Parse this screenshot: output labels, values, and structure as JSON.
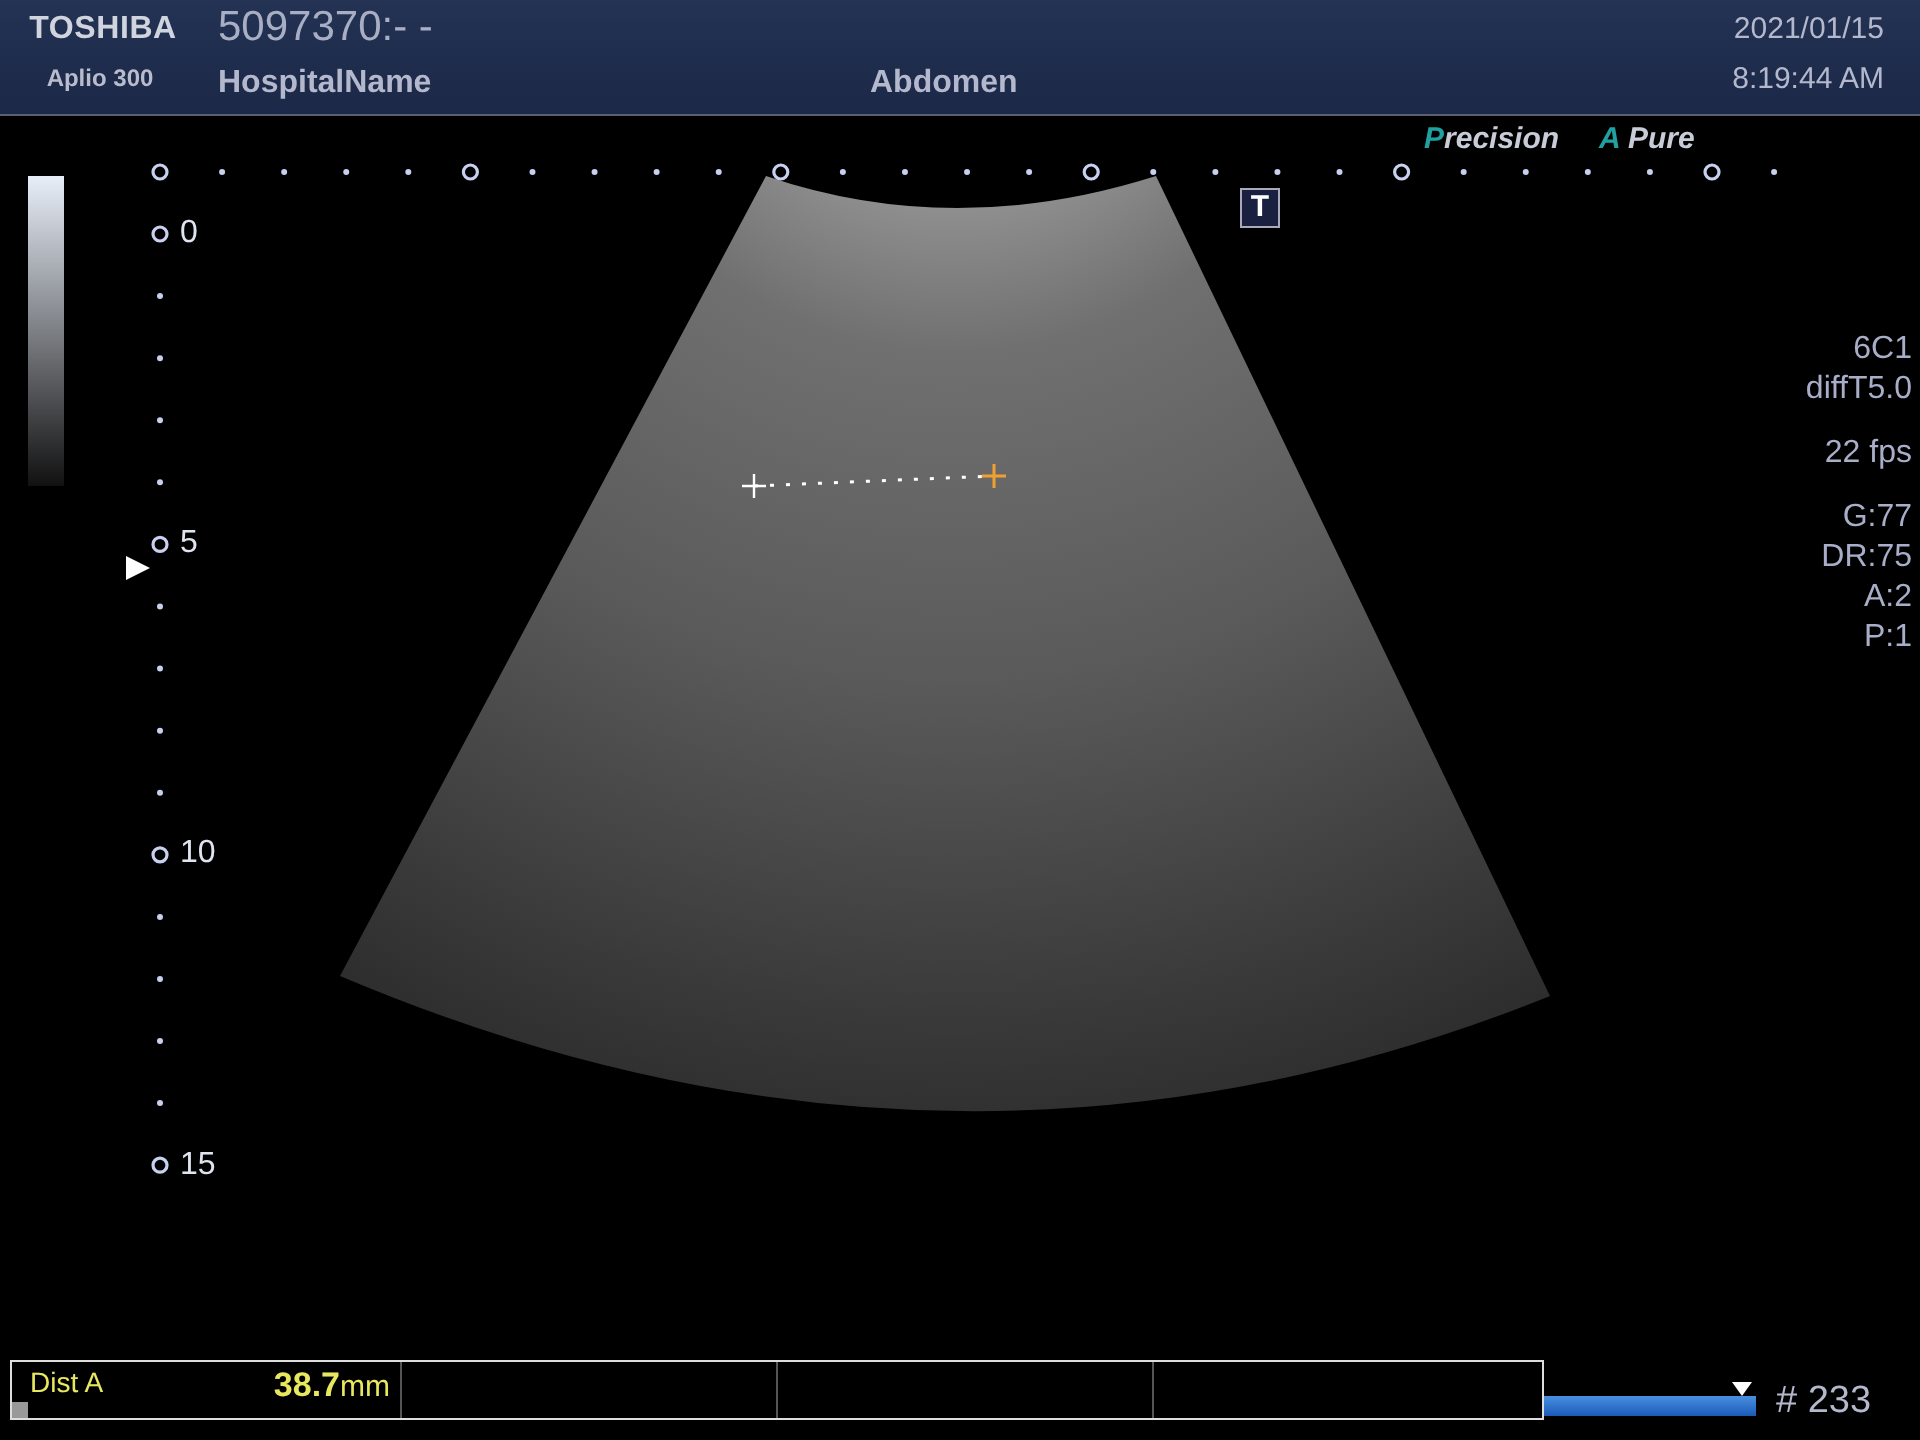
{
  "header": {
    "brand": "TOSHIBA",
    "model": "Aplio 300",
    "patient_id": "5097370:- -",
    "hospital": "HospitalName",
    "exam": "Abdomen",
    "date": "2021/01/15",
    "time": "8:19:44 AM"
  },
  "logos": [
    "Precision",
    "A Pure"
  ],
  "mode_badge": "T",
  "depth_labels": [
    "0",
    "5",
    "10",
    "15"
  ],
  "parameters": [
    [
      "6C1",
      "diffT5.0"
    ],
    [
      "22 fps"
    ],
    [
      "G:77",
      "DR:75",
      "A:2",
      "P:1"
    ]
  ],
  "measurement": {
    "label": "Dist A",
    "value": "38.7",
    "unit": "mm"
  },
  "cine": {
    "level": 1.0,
    "frame": "# 233"
  }
}
